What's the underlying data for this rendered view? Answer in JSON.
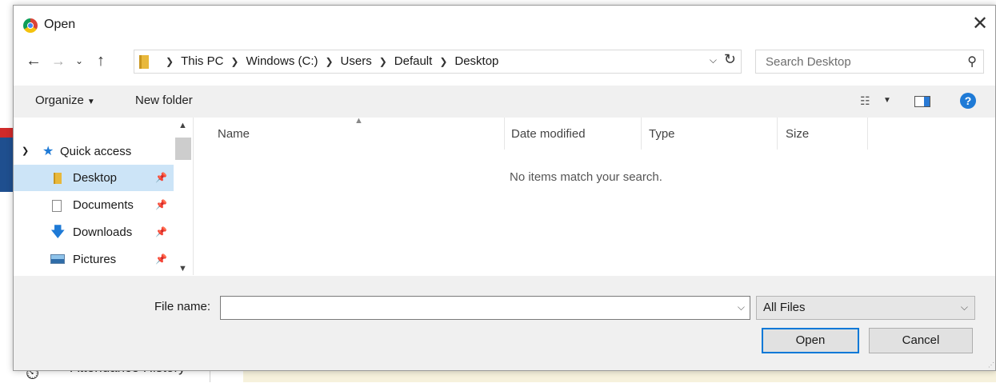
{
  "background": {
    "app_text": "Attendance History"
  },
  "dialog": {
    "title": "Open",
    "nav": {
      "back_icon": "←",
      "forward_icon": "→",
      "recent_icon": "⌄",
      "up_icon": "↑"
    },
    "address": {
      "crumbs": [
        "This PC",
        "Windows (C:)",
        "Users",
        "Default",
        "Desktop"
      ]
    },
    "search": {
      "placeholder": "Search Desktop"
    },
    "toolbar": {
      "organize_label": "Organize",
      "new_folder_label": "New folder"
    },
    "navpane": {
      "quick_access_label": "Quick access",
      "items": [
        {
          "label": "Desktop",
          "icon": "folder-icon"
        },
        {
          "label": "Documents",
          "icon": "documents-icon"
        },
        {
          "label": "Downloads",
          "icon": "downloads-icon"
        },
        {
          "label": "Pictures",
          "icon": "pictures-icon"
        }
      ]
    },
    "columns": [
      "Name",
      "Date modified",
      "Type",
      "Size"
    ],
    "empty_message": "No items match your search.",
    "file_name_label": "File name:",
    "file_name_value": "",
    "file_type": "All Files",
    "open_label": "Open",
    "cancel_label": "Cancel"
  },
  "colors": {
    "accent": "#0078d7",
    "selected_bg": "#cce4f7",
    "toolbar_bg": "#f0f0f0"
  }
}
